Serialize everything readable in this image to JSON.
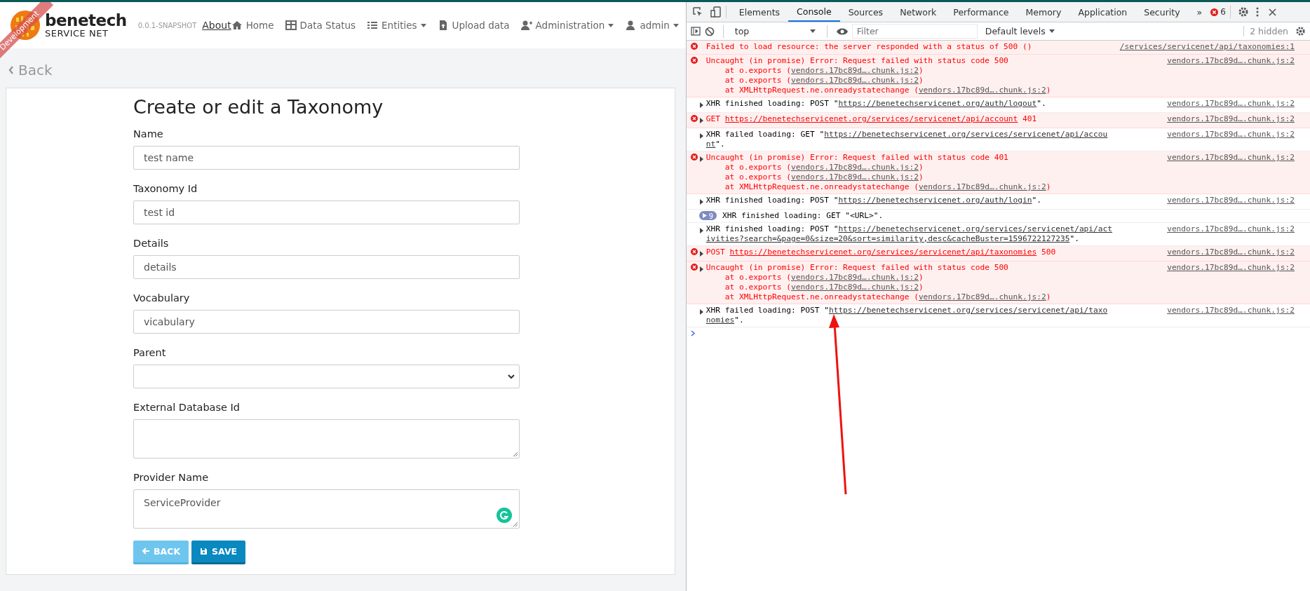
{
  "app": {
    "ribbon": "Development",
    "brand": {
      "name": "benetech",
      "sub": "SERVICE NET"
    },
    "version": "0.0.1-SNAPSHOT",
    "about": "About",
    "nav": [
      {
        "label": "Home",
        "dropdown": false
      },
      {
        "label": "Data Status",
        "dropdown": false
      },
      {
        "label": "Entities",
        "dropdown": true
      },
      {
        "label": "Upload data",
        "dropdown": false
      },
      {
        "label": "Administration",
        "dropdown": true
      },
      {
        "label": "admin",
        "dropdown": true
      }
    ],
    "back": "Back",
    "form": {
      "title": "Create or edit a Taxonomy",
      "fields": [
        {
          "kind": "input",
          "label": "Name",
          "value": "test name"
        },
        {
          "kind": "input",
          "label": "Taxonomy Id",
          "value": "test id"
        },
        {
          "kind": "input",
          "label": "Details",
          "value": "details"
        },
        {
          "kind": "input",
          "label": "Vocabulary",
          "value": "vicabulary"
        },
        {
          "kind": "select",
          "label": "Parent"
        },
        {
          "kind": "textarea",
          "label": "External Database Id",
          "grammarly": false
        },
        {
          "kind": "textarea",
          "label": "Provider Name",
          "value": "ServiceProvider",
          "grammarly": true
        }
      ],
      "buttons": [
        {
          "kind": "back",
          "label": "BACK"
        },
        {
          "kind": "save",
          "label": "SAVE"
        }
      ]
    }
  },
  "devtools": {
    "tabs": [
      {
        "label": "Elements",
        "selected": false
      },
      {
        "label": "Console",
        "selected": true
      },
      {
        "label": "Sources",
        "selected": false
      },
      {
        "label": "Network",
        "selected": false
      },
      {
        "label": "Performance",
        "selected": false
      },
      {
        "label": "Memory",
        "selected": false
      },
      {
        "label": "Application",
        "selected": false
      },
      {
        "label": "Security",
        "selected": false
      }
    ],
    "more": "»",
    "error_count": "6",
    "context": "top",
    "filter_placeholder": "Filter",
    "levels": "Default levels",
    "hidden": "2 hidden",
    "entries": [
      {
        "kind": "error",
        "expandable": false,
        "message": {
          "prefix": "Failed to load resource: the server responded with a status of 500 ()"
        },
        "source": "/services/servicenet/api/taxonomies:1"
      },
      {
        "kind": "error",
        "expandable": false,
        "message": {
          "prefix": "Uncaught (in promise) Error: Request failed with status code 500"
        },
        "stack": [
          {
            "prefix": "at o.exports (",
            "url": "vendors.17bc89d….chunk.js:2",
            "suffix": ")"
          },
          {
            "prefix": "at o.exports (",
            "url": "vendors.17bc89d….chunk.js:2",
            "suffix": ")"
          },
          {
            "prefix": "at XMLHttpRequest.ne.onreadystatechange (",
            "url": "vendors.17bc89d….chunk.js:2",
            "suffix": ")"
          }
        ],
        "source": "vendors.17bc89d….chunk.js:2"
      },
      {
        "kind": "log",
        "expandable": true,
        "message": {
          "prefix": "XHR finished loading: POST \"",
          "url": "https://benetechservicenet.org/auth/logout",
          "suffix": "\"."
        },
        "source": "vendors.17bc89d….chunk.js:2"
      },
      {
        "kind": "error",
        "expandable": true,
        "message": {
          "prefix": "GET ",
          "url": "https://benetechservicenet.org/services/servicenet/api/account",
          "suffix": " 401"
        },
        "source": "vendors.17bc89d….chunk.js:2"
      },
      {
        "kind": "log",
        "expandable": true,
        "message": {
          "prefix": "XHR failed loading: GET \"",
          "url": "https://benetechservicenet.org/services/servicenet/api/account",
          "suffix": "\"."
        },
        "source": "vendors.17bc89d….chunk.js:2"
      },
      {
        "kind": "error",
        "expandable": true,
        "message": {
          "prefix": "Uncaught (in promise) Error: Request failed with status code 401"
        },
        "stack": [
          {
            "prefix": "at o.exports (",
            "url": "vendors.17bc89d….chunk.js:2",
            "suffix": ")"
          },
          {
            "prefix": "at o.exports (",
            "url": "vendors.17bc89d….chunk.js:2",
            "suffix": ")"
          },
          {
            "prefix": "at XMLHttpRequest.ne.onreadystatechange (",
            "url": "vendors.17bc89d….chunk.js:2",
            "suffix": ")"
          }
        ],
        "source": "vendors.17bc89d….chunk.js:2"
      },
      {
        "kind": "log",
        "expandable": true,
        "message": {
          "prefix": "XHR finished loading: POST \"",
          "url": "https://benetechservicenet.org/auth/login",
          "suffix": "\"."
        },
        "source": "vendors.17bc89d….chunk.js:2"
      },
      {
        "kind": "group",
        "expandable": true,
        "count": "9",
        "message": {
          "prefix": "XHR finished loading: GET \"<URL>\"."
        }
      },
      {
        "kind": "log",
        "expandable": true,
        "message": {
          "prefix": "XHR finished loading: POST \"",
          "url": "https://benetechservicenet.org/services/servicenet/api/activities?search=&page=0&size=20&sort=similarity,desc&cacheBuster=1596722127235",
          "suffix": "\"."
        },
        "source": "vendors.17bc89d….chunk.js:2"
      },
      {
        "kind": "error",
        "expandable": true,
        "message": {
          "prefix": "POST ",
          "url": "https://benetechservicenet.org/services/servicenet/api/taxonomies",
          "suffix": " 500"
        },
        "source": "vendors.17bc89d….chunk.js:2"
      },
      {
        "kind": "error",
        "expandable": true,
        "message": {
          "prefix": "Uncaught (in promise) Error: Request failed with status code 500"
        },
        "stack": [
          {
            "prefix": "at o.exports (",
            "url": "vendors.17bc89d….chunk.js:2",
            "suffix": ")"
          },
          {
            "prefix": "at o.exports (",
            "url": "vendors.17bc89d….chunk.js:2",
            "suffix": ")"
          },
          {
            "prefix": "at XMLHttpRequest.ne.onreadystatechange (",
            "url": "vendors.17bc89d….chunk.js:2",
            "suffix": ")"
          }
        ],
        "source": "vendors.17bc89d….chunk.js:2"
      },
      {
        "kind": "log",
        "expandable": true,
        "message": {
          "prefix": "XHR failed loading: POST \"",
          "url": "https://benetechservicenet.org/services/servicenet/api/taxonomies",
          "suffix": "\"."
        },
        "source": "vendors.17bc89d….chunk.js:2"
      }
    ]
  }
}
